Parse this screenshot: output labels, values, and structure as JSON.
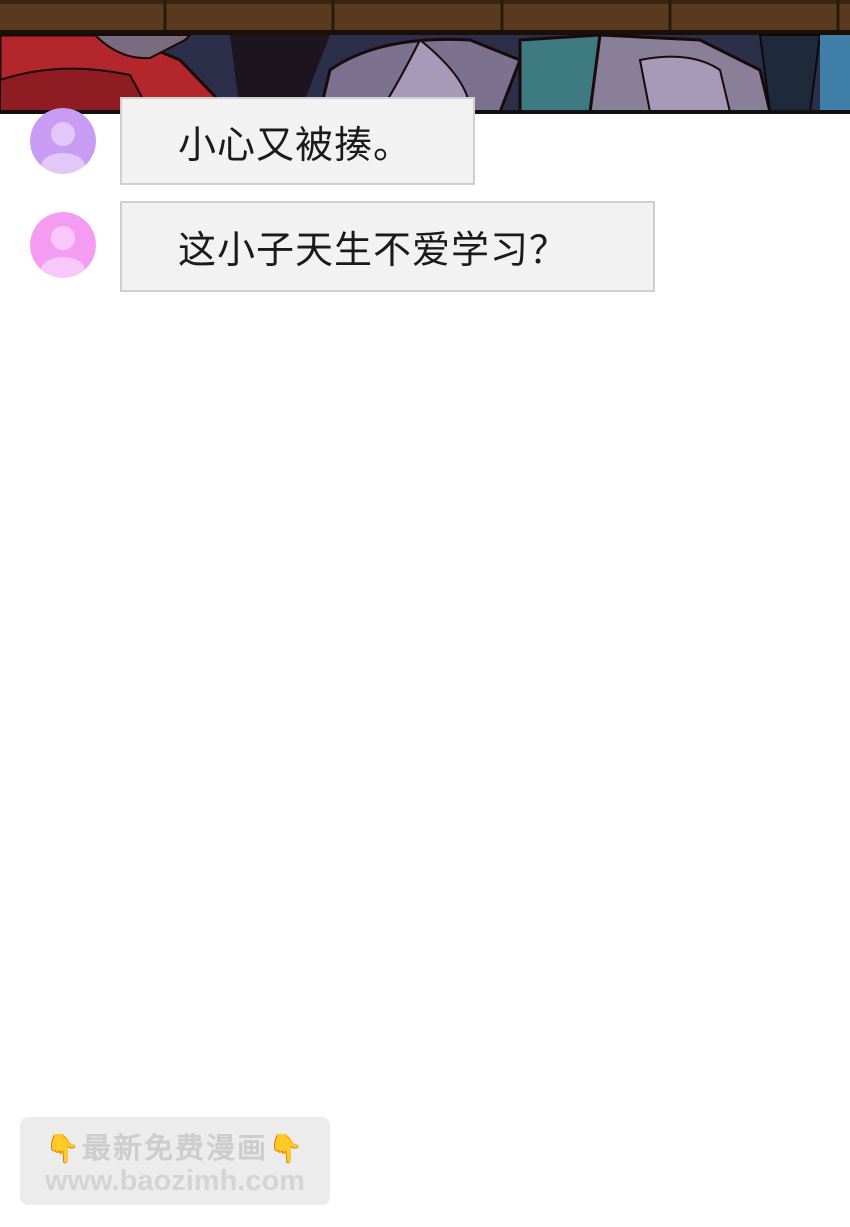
{
  "comic_panel": {
    "description_icon": "comic-artwork"
  },
  "comments": [
    {
      "avatar_color": "#c89cf2",
      "avatar_icon": "default-user-avatar-icon",
      "text": "小心又被揍。"
    },
    {
      "avatar_color": "#f39cf2",
      "avatar_icon": "default-user-avatar-icon",
      "text": "这小子天生不爱学习？"
    }
  ],
  "watermark": {
    "line1_text": "最新免费漫画",
    "line1_icon": "pointing-down-hand-icon",
    "line2_text": "www.baozimh.com"
  }
}
